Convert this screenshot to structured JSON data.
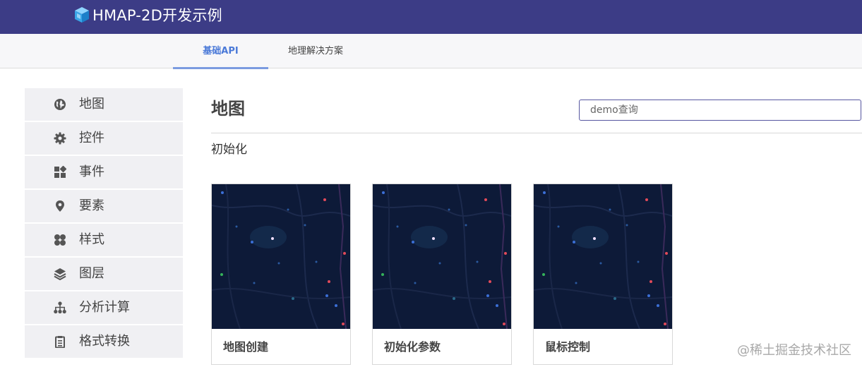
{
  "header": {
    "app_title": "HMAP-2D开发示例",
    "logo": "cube-logo-icon"
  },
  "tabs": [
    {
      "label": "基础API",
      "active": true
    },
    {
      "label": "地理解决方案",
      "active": false
    }
  ],
  "sidebar": {
    "items": [
      {
        "label": "地图",
        "icon": "globe-icon"
      },
      {
        "label": "控件",
        "icon": "gear-icon"
      },
      {
        "label": "事件",
        "icon": "widgets-icon"
      },
      {
        "label": "要素",
        "icon": "map-pin-icon"
      },
      {
        "label": "样式",
        "icon": "four-circles-icon"
      },
      {
        "label": "图层",
        "icon": "layers-icon"
      },
      {
        "label": "分析计算",
        "icon": "hierarchy-icon"
      },
      {
        "label": "格式转换",
        "icon": "clipboard-icon"
      }
    ]
  },
  "main": {
    "title": "地图",
    "search": {
      "placeholder": "demo查询",
      "value": ""
    },
    "section_title": "初始化",
    "cards": [
      {
        "caption": "地图创建"
      },
      {
        "caption": "初始化参数"
      },
      {
        "caption": "鼠标控制"
      }
    ]
  },
  "watermark": "@稀土掘金技术社区",
  "colors": {
    "header_bg": "#3c3c86",
    "tab_active": "#4a79d8",
    "map_bg": "#0d1a38",
    "sidebar_bg": "#f0f0f3"
  }
}
